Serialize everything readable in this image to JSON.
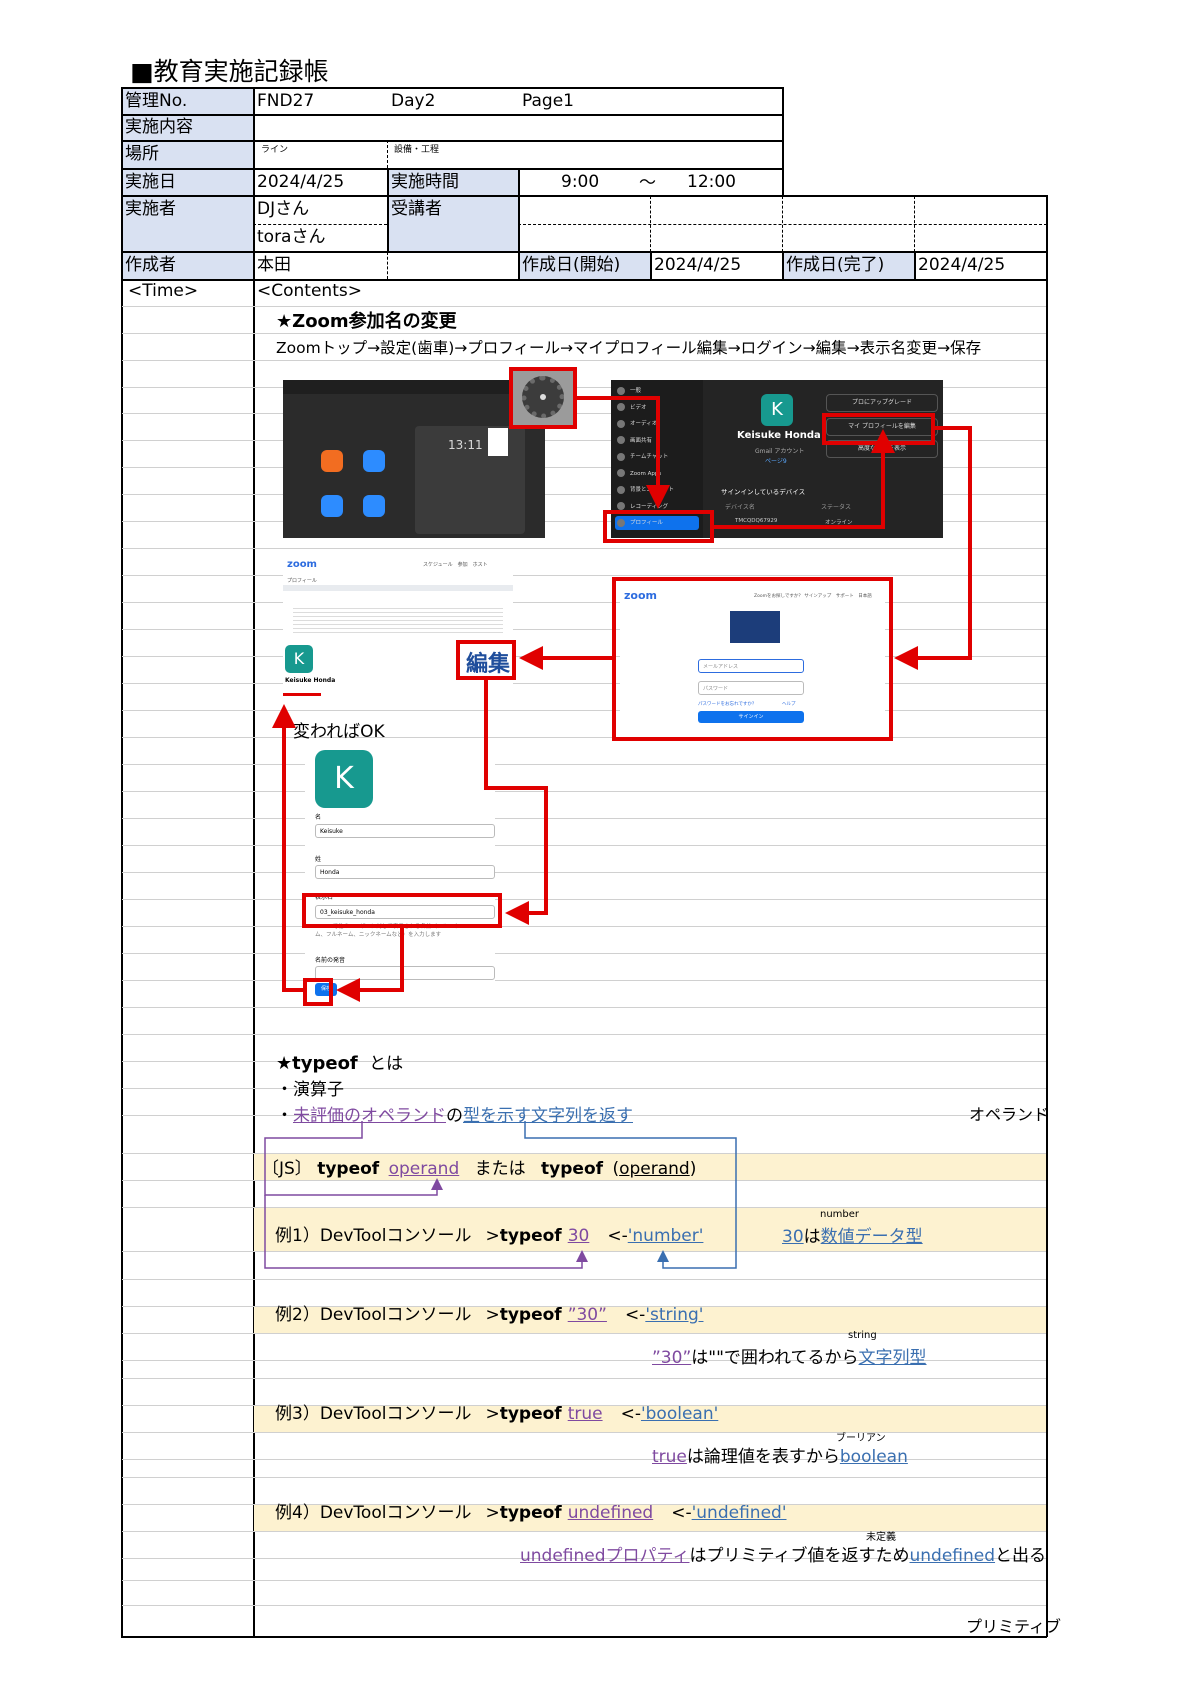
{
  "title": "■教育実施記録帳",
  "header": {
    "kanri_label": "管理No.",
    "kanri_value": "FND27",
    "day": "Day2",
    "page": "Page1",
    "naiyou_label": "実施内容",
    "basho_label": "場所",
    "basho_sub1": "ライン",
    "basho_sub2": "設備・工程",
    "date_label": "実施日",
    "date_value": "2024/4/25",
    "time_label": "実施時間",
    "time_start": "9:00",
    "time_sep": "～",
    "time_end": "12:00",
    "jisshisha_label": "実施者",
    "jisshisha_1": "DJさん",
    "jisshisha_2": "toraさん",
    "jukousha_label": "受講者",
    "sakuseisha_label": "作成者",
    "sakuseisha_value": "本田",
    "start_label": "作成日(開始)",
    "start_value": "2024/4/25",
    "end_label": "作成日(完了)",
    "end_value": "2024/4/25"
  },
  "columns": {
    "time": "<Time>",
    "contents": "<Contents>"
  },
  "zoom_section": {
    "heading": "★Zoom参加名の変更",
    "steps": "Zoomトップ→設定(歯車)→プロフィール→マイプロフィール編集→ログイン→編集→表示名変更→保存",
    "ok_note": "変わればOK",
    "shot1": {
      "clock": "13:11"
    },
    "shot2": {
      "menu": [
        "一般",
        "ビデオ",
        "オーディオ",
        "画面共有",
        "チームチャット",
        "Zoom Apps",
        "背景とエフェクト",
        "レコーディング",
        "プロフィール"
      ],
      "name": "Keisuke Honda",
      "account": "Gmail アカウント",
      "page_link": "ページ9",
      "upgrade": "プロにアップグレード",
      "edit_profile": "マイ プロフィールを編集",
      "show": "高度な機能を表示",
      "devices": "サインインしているデバイス",
      "device_col": "デバイス名",
      "status_col": "ステータス",
      "device": "TMCQDQ67929",
      "status": "オンライン"
    },
    "shot3": {
      "logo": "zoom",
      "nav": "スケジュール　参加　ホスト",
      "crumb": "プロフィール",
      "edit_label": "編集",
      "avatar": "K",
      "name": "Keisuke Honda"
    },
    "shot4": {
      "logo": "zoom",
      "nav": "Zoomをお探しですか？ サインアップ　サポート　日本語",
      "email": "メールアドレス",
      "password": "パスワード",
      "signin": "サインイン",
      "forgot": "パスワードをお忘れですか？",
      "help": "ヘルプ"
    },
    "shot5": {
      "avatar": "K",
      "first_label": "名",
      "first_value": "Keisuke",
      "last_label": "姓",
      "last_value": "Honda",
      "display_label": "表示名",
      "display_value": "03_keisuke_honda",
      "hint": "Zoom で他のユーザーに対して表示される名前（フル・ネーム、フルネーム、ニックネームなど）を入力します",
      "pron_label": "名前の発音",
      "save": "保存"
    }
  },
  "typeof_section": {
    "heading": "★typeof",
    "heading_suffix": "とは",
    "bullet1": "・演算子",
    "bullet2_prefix": "・",
    "bullet2_link1": "未評価のオペランド",
    "bullet2_mid": "の",
    "bullet2_link2": "型を示す文字列を返す",
    "side_note": "オペランド",
    "syntax": {
      "prefix": "〔JS〕",
      "kw1": "typeof",
      "op1": "operand",
      "mid": "または",
      "kw2": "typeof",
      "paren_open": "(",
      "op2": "operand",
      "paren_close": ")"
    },
    "examples": [
      {
        "label": "例1）DevToolコンソール",
        "prompt": ">",
        "kw": "typeof",
        "arg": "30",
        "arrow": "<-",
        "result": "'number'"
      },
      {
        "label": "例2）DevToolコンソール",
        "prompt": ">",
        "kw": "typeof",
        "arg": "”30”",
        "arrow": "<-",
        "result": "'string'"
      },
      {
        "label": "例3）DevToolコンソール",
        "prompt": ">",
        "kw": "typeof",
        "arg": "true",
        "arrow": "<-",
        "result": "'boolean'"
      },
      {
        "label": "例4）DevToolコンソール",
        "prompt": ">",
        "kw": "typeof",
        "arg": "undefined",
        "arrow": "<-",
        "result": "'undefined'"
      }
    ],
    "notes": {
      "n1_ruby": "number",
      "n1_a": "30",
      "n1_b": "は",
      "n1_c": "数値データ型",
      "n2_ruby": "string",
      "n2_a": "”30”",
      "n2_b": "は\"\"で囲われてるから",
      "n2_c": "文字列型",
      "n3_ruby": "ブーリアン",
      "n3_a": "true",
      "n3_b": "は論理値を表すから",
      "n3_c": "boolean",
      "n4_ruby": "未定義",
      "n4_a": "undefinedプロパティ",
      "n4_b": "はプリミティブ値を返すため",
      "n4_c": "undefined",
      "n4_d": "と出る"
    },
    "footer_note": "プリミティブ"
  },
  "colors": {
    "shade": "#d9e1f2",
    "highlight": "#fdf2d0",
    "link": "#3a6fb0",
    "purple": "#7f4aa0",
    "red": "#e00000"
  }
}
